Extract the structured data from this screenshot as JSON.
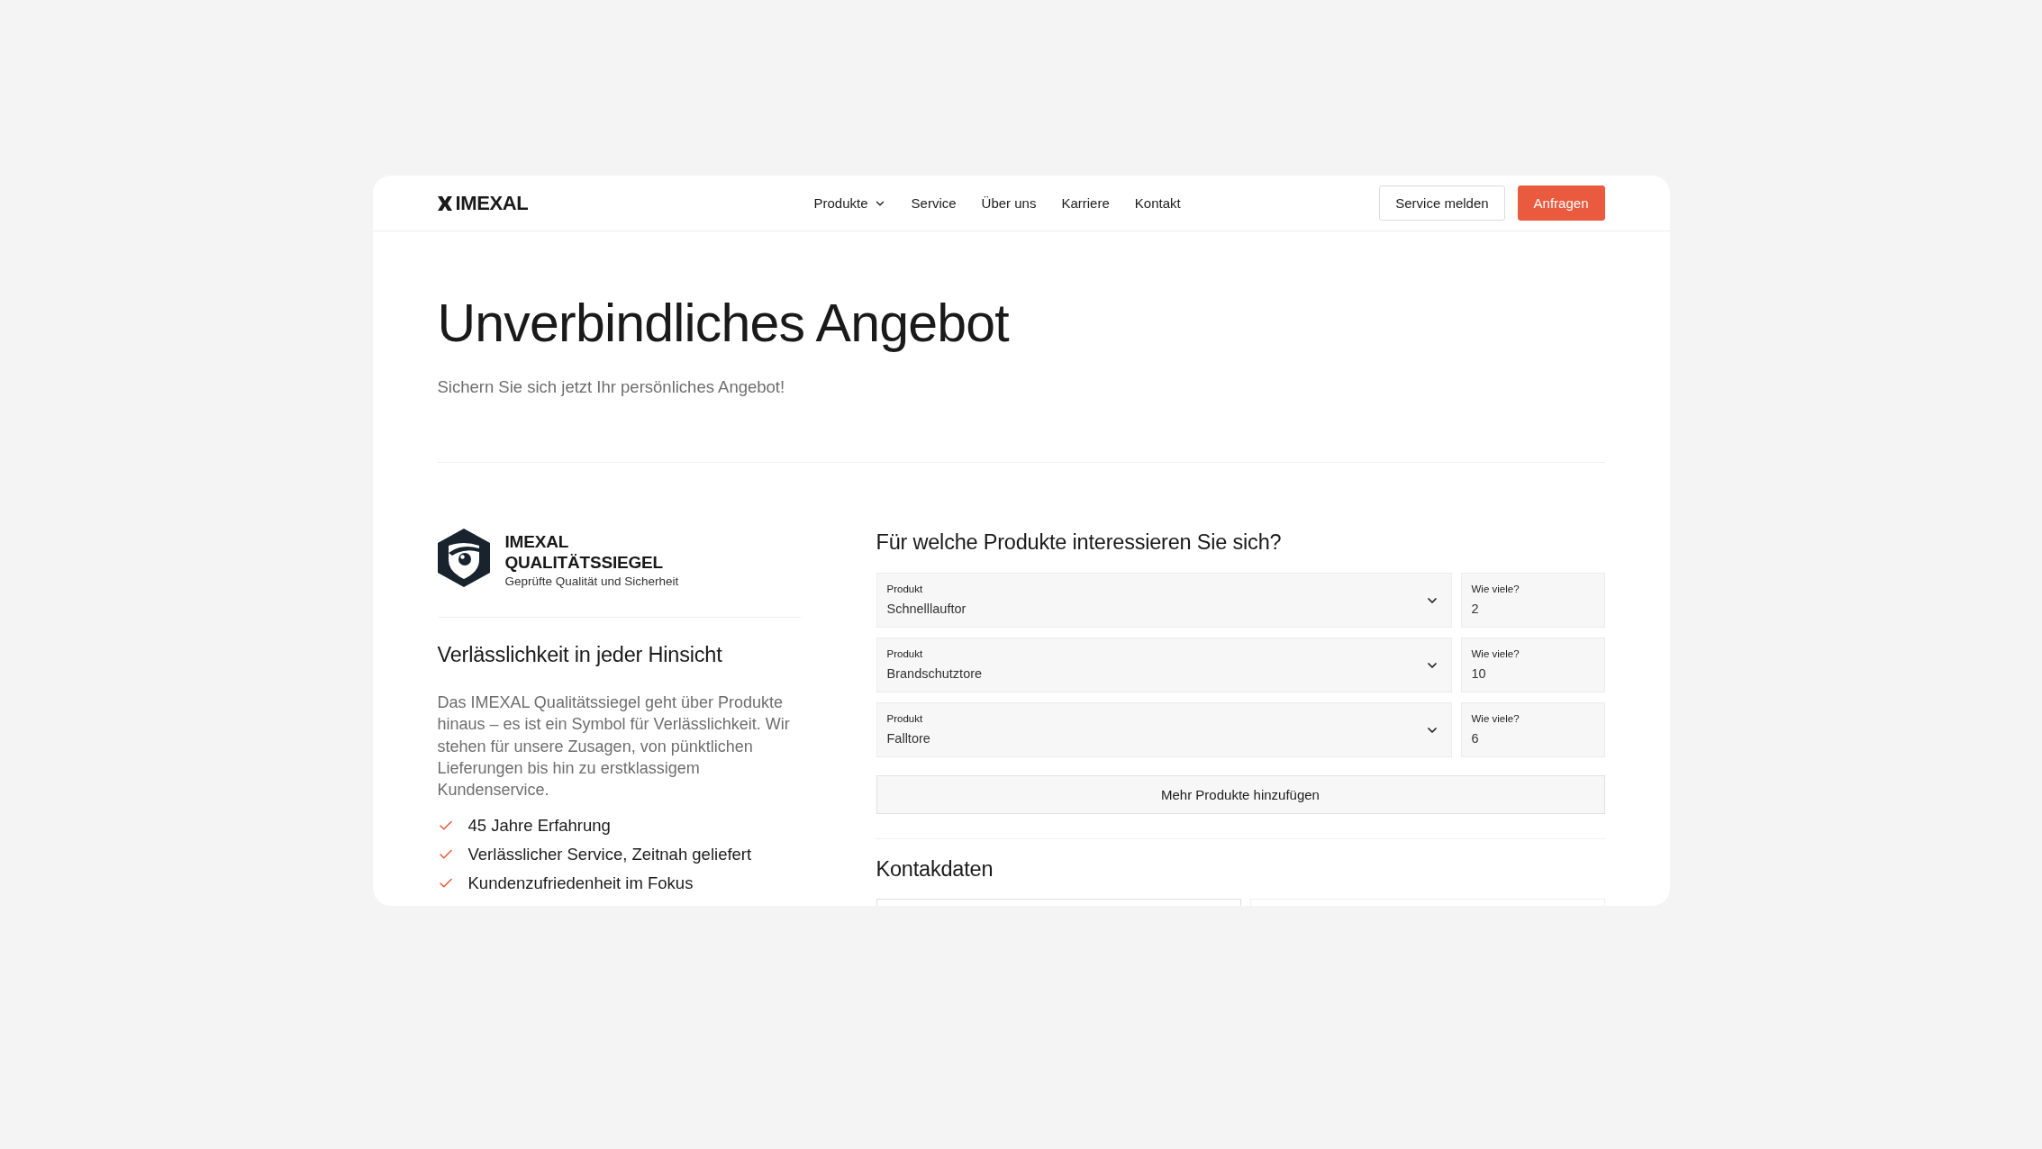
{
  "header": {
    "logo": "IMEXAL",
    "nav": [
      {
        "label": "Produkte",
        "has_menu": true
      },
      {
        "label": "Service",
        "has_menu": false
      },
      {
        "label": "Über uns",
        "has_menu": false
      },
      {
        "label": "Karriere",
        "has_menu": false
      },
      {
        "label": "Kontakt",
        "has_menu": false
      }
    ],
    "actions": [
      {
        "label": "Service melden",
        "kind": "secondary"
      },
      {
        "label": "Anfragen",
        "kind": "primary"
      }
    ]
  },
  "hero": {
    "title": "Unverbindliches Angebot",
    "subtitle": "Sichern Sie sich jetzt Ihr persönliches Angebot!"
  },
  "seal": {
    "title": "IMEXAL QUALITÄTSSIEGEL",
    "tagline": "Geprüfte Qualität und Sicherheit"
  },
  "reliability": {
    "heading": "Verlässlichkeit in jeder Hinsicht",
    "text": "Das IMEXAL Qualitätssiegel geht über Produkte hinaus – es ist ein Symbol für Verlässlichkeit. Wir stehen für unsere Zusagen, von pünktlichen Lieferungen bis hin zu erstklassigem Kundenservice.",
    "features": [
      "45 Jahre Erfahrung",
      "Verlässlicher Service, Zeitnah geliefert",
      "Kundenzufriedenheit im Fokus"
    ]
  },
  "product_form": {
    "heading": "Für welche Produkte interessieren Sie sich?",
    "rows": [
      {
        "product_label": "Produkt",
        "product": "Schnelllauftor",
        "quantity_label": "Wie viele?",
        "quantity": "2"
      },
      {
        "product_label": "Produkt",
        "product": "Brandschutztore",
        "quantity_label": "Wie viele?",
        "quantity": "10"
      },
      {
        "product_label": "Produkt",
        "product": "Falltore",
        "quantity_label": "Wie viele?",
        "quantity": "6"
      }
    ],
    "add_button": "Mehr Produkte hinzufügen"
  },
  "contact": {
    "heading": "Kontakdaten"
  }
}
